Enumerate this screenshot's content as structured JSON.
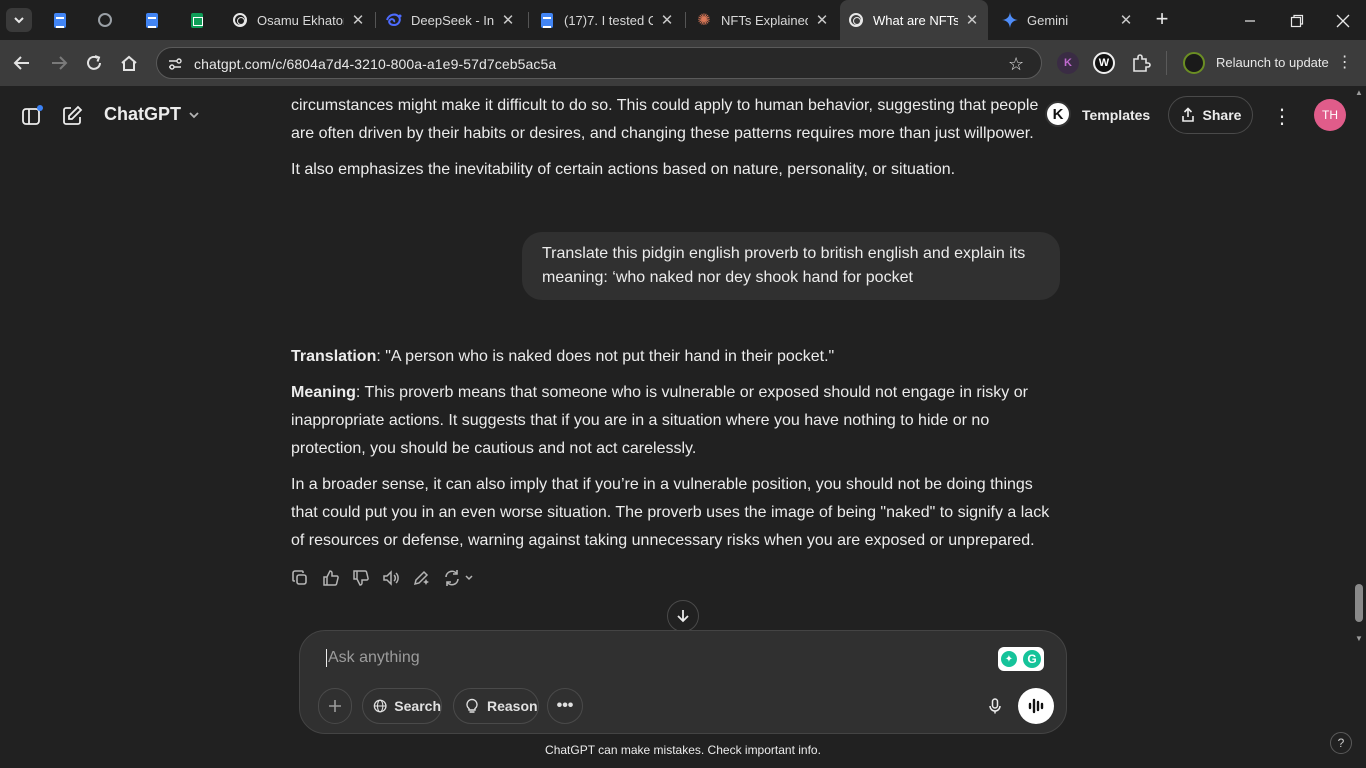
{
  "browser": {
    "tabs": [
      {
        "title": "",
        "favicon": "docs-icon"
      },
      {
        "title": "",
        "favicon": "globe-icon"
      },
      {
        "title": "",
        "favicon": "docs-icon"
      },
      {
        "title": "",
        "favicon": "sheets-icon"
      },
      {
        "title": "Osamu Ekhator",
        "favicon": "chatgpt-icon"
      },
      {
        "title": "DeepSeek - Into",
        "favicon": "deepseek-icon"
      },
      {
        "title": "(17)7. I tested C",
        "favicon": "docs-icon"
      },
      {
        "title": "NFTs Explained",
        "favicon": "claude-icon"
      },
      {
        "title": "What are NFTs",
        "favicon": "chatgpt-icon",
        "active": true
      },
      {
        "title": "Gemini",
        "favicon": "gemini-icon"
      }
    ],
    "url": "chatgpt.com/c/6804a7d4-3210-800a-a1e9-57d7ceb5ac5a",
    "relaunch_label": "Relaunch to update",
    "extensions": [
      "K",
      "W"
    ]
  },
  "app": {
    "brand": "ChatGPT",
    "templates_label": "Templates",
    "share_label": "Share",
    "k_badge": "K",
    "avatar_initials": "TH"
  },
  "conversation": {
    "prev_line1": "circumstances might make it difficult to do so. This could apply to human behavior, suggesting that people",
    "prev_line2": "are often driven by their habits or desires, and changing these patterns requires more than just willpower.",
    "prev_para2": "It also emphasizes the inevitability of certain actions based on nature, personality, or situation.",
    "user_message": "Translate this pidgin english proverb to british english and explain its meaning: ‘who naked nor dey shook hand for pocket",
    "translation_label": "Translation",
    "translation_text": ": \"A person who is naked does not put their hand in their pocket.\"",
    "meaning_label": "Meaning",
    "meaning_text": ": This proverb means that someone who is vulnerable or exposed should not engage in risky or inappropriate actions. It suggests that if you are in a situation where you have nothing to hide or no protection, you should be cautious and not act carelessly.",
    "broader_text": "In a broader sense, it can also imply that if you’re in a vulnerable position, you should not be doing things that could put you in an even worse situation. The proverb uses the image of being \"naked\" to signify a lack of resources or defense, warning against taking unnecessary risks when you are exposed or unprepared."
  },
  "composer": {
    "placeholder": "Ask anything",
    "search_label": "Search",
    "reason_label": "Reason"
  },
  "footer": {
    "disclaimer": "ChatGPT can make mistakes. Check important info.",
    "help": "?"
  }
}
